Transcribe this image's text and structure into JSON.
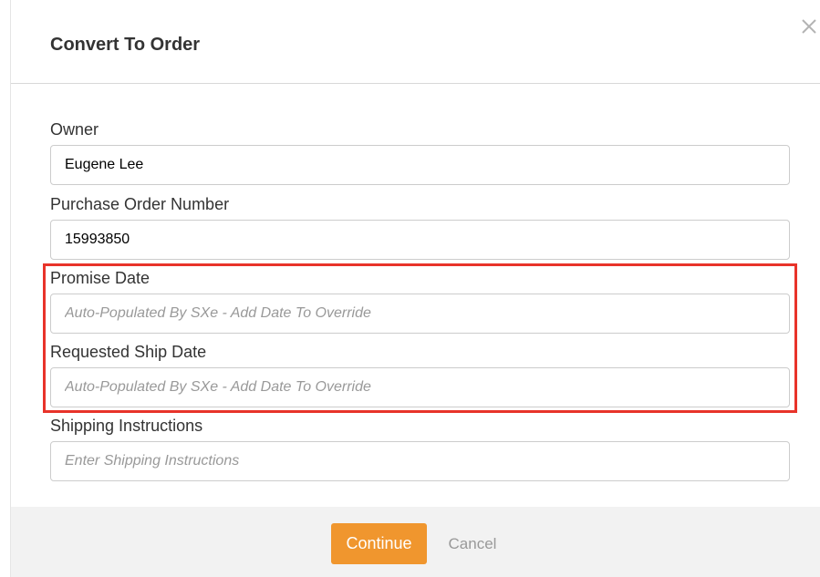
{
  "dialog": {
    "title": "Convert To Order",
    "close_icon": "close-icon"
  },
  "fields": {
    "owner": {
      "label": "Owner",
      "value": "Eugene Lee"
    },
    "po_number": {
      "label": "Purchase Order Number",
      "value": "15993850"
    },
    "promise_date": {
      "label": "Promise Date",
      "value": "",
      "placeholder": "Auto-Populated By SXe - Add Date To Override"
    },
    "requested_ship_date": {
      "label": "Requested Ship Date",
      "value": "",
      "placeholder": "Auto-Populated By SXe - Add Date To Override"
    },
    "shipping_instructions": {
      "label": "Shipping Instructions",
      "value": "",
      "placeholder": "Enter Shipping Instructions"
    }
  },
  "footer": {
    "continue_label": "Continue",
    "cancel_label": "Cancel"
  },
  "colors": {
    "accent": "#f0962e",
    "highlight": "#e8332a",
    "footer_bg": "#f2f2f2"
  }
}
